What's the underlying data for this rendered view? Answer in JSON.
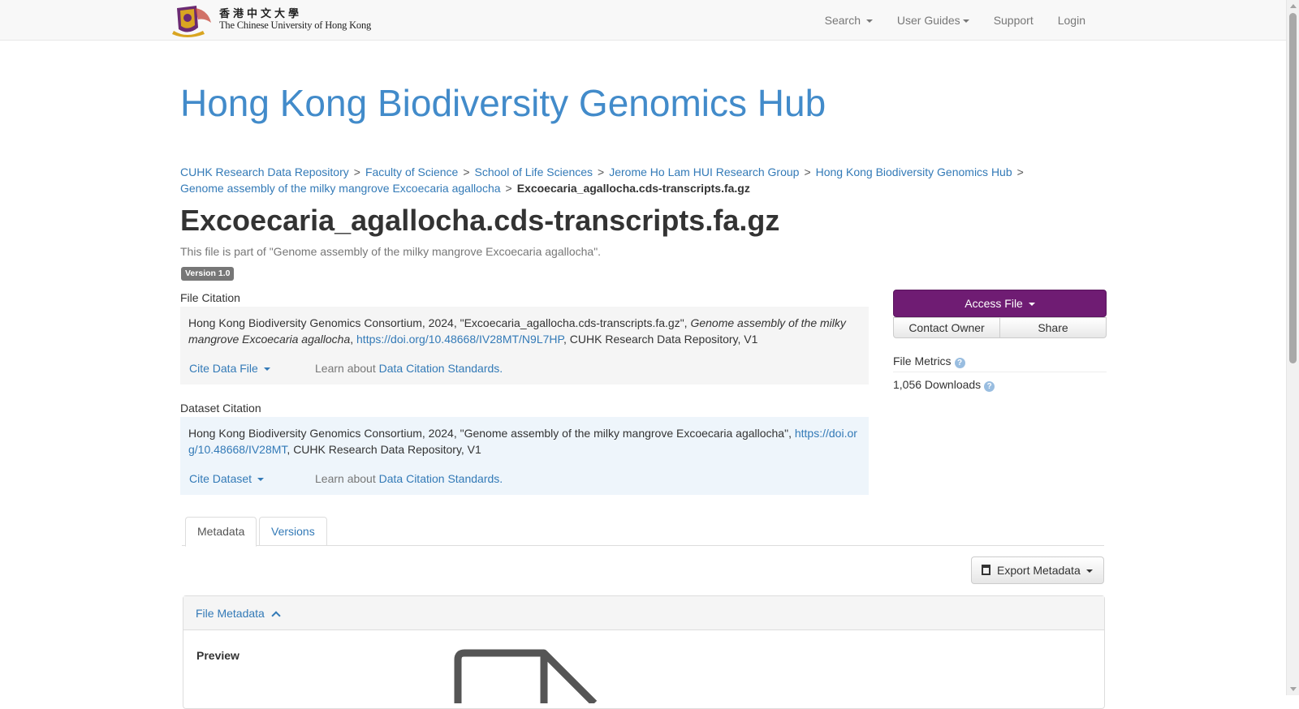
{
  "brand": {
    "name_cn": "香港中文大學",
    "name_en": "The Chinese University of Hong Kong"
  },
  "nav": {
    "search": "Search",
    "user_guides": "User Guides",
    "support": "Support",
    "login": "Login"
  },
  "hub_title": "Hong Kong Biodiversity Genomics Hub",
  "breadcrumb": [
    "CUHK Research Data Repository",
    "Faculty of Science",
    "School of Life Sciences",
    "Jerome Ho Lam HUI Research Group",
    "Hong Kong Biodiversity Genomics Hub",
    "Genome assembly of the milky mangrove Excoecaria agallocha",
    "Excoecaria_agallocha.cds-transcripts.fa.gz"
  ],
  "file_title": "Excoecaria_agallocha.cds-transcripts.fa.gz",
  "part_of": "This file is part of \"Genome assembly of the milky mangrove Excoecaria agallocha\".",
  "version_label": "Version 1.0",
  "file_citation": {
    "label": "File Citation",
    "text_start": "Hong Kong Biodiversity Genomics Consortium, 2024, \"Excoecaria_agallocha.cds-transcripts.fa.gz\", ",
    "text_italic": "Genome assembly of the milky mangrove Excoecaria agallocha",
    "text_sep": ", ",
    "doi": "https://doi.org/10.48668/IV28MT/N9L7HP",
    "text_end": ", CUHK Research Data Repository, V1",
    "cite_button": "Cite Data File",
    "learn_prefix": "Learn about ",
    "learn_link": "Data Citation Standards.",
    "learn_suffix": ""
  },
  "dataset_citation": {
    "label": "Dataset Citation",
    "text_start": "Hong Kong Biodiversity Genomics Consortium, 2024, \"Genome assembly of the milky mangrove Excoecaria agallocha\", ",
    "doi": "https://doi.org/10.48668/IV28MT",
    "text_end": ", CUHK Research Data Repository, V1",
    "cite_button": "Cite Dataset",
    "learn_prefix": "Learn about ",
    "learn_link": "Data Citation Standards."
  },
  "actions": {
    "access_file": "Access File",
    "contact_owner": "Contact Owner",
    "share": "Share"
  },
  "metrics": {
    "heading": "File Metrics",
    "downloads": "1,056 Downloads"
  },
  "tabs": {
    "metadata": "Metadata",
    "versions": "Versions"
  },
  "export_metadata": "Export Metadata",
  "file_metadata": {
    "heading": "File Metadata",
    "preview_label": "Preview"
  },
  "colors": {
    "link": "#337ab7",
    "hub_title": "#428bca",
    "access_button": "#6f1c73"
  }
}
